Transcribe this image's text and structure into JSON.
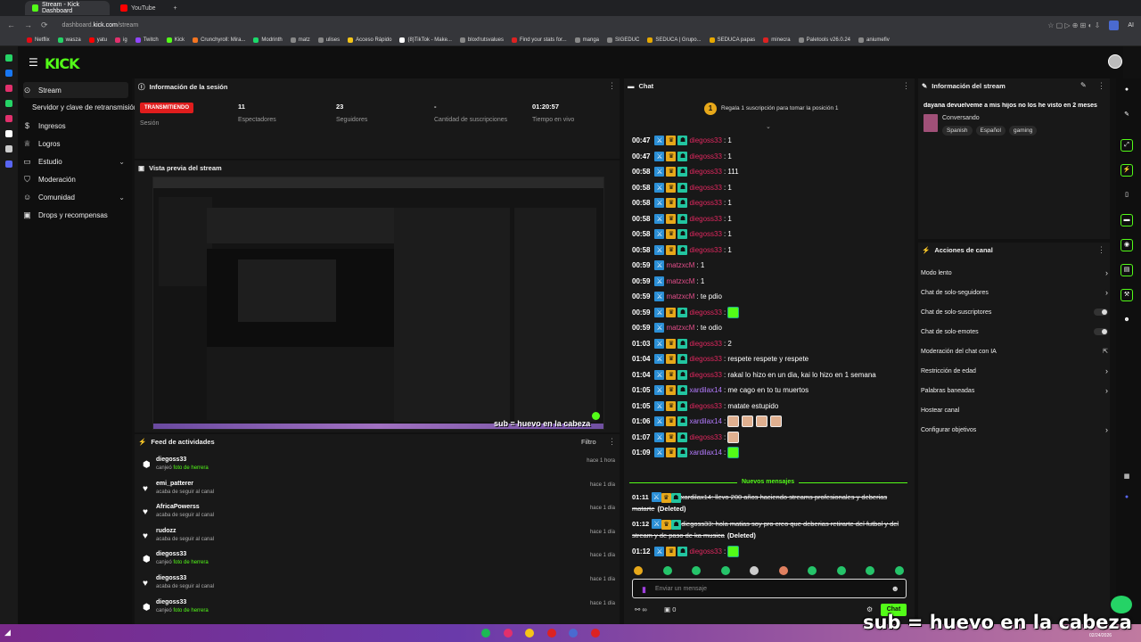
{
  "browser": {
    "tabs": [
      {
        "label": "Stream - Kick Dashboard",
        "color": "#53fc18"
      },
      {
        "label": "YouTube",
        "color": "#ff0000"
      }
    ],
    "url_prefix": "dashboard.",
    "url_domain": "kick.com",
    "url_path": "/stream",
    "ext_label": "AI",
    "bookmarks": [
      {
        "label": "Netflix",
        "color": "#e50914"
      },
      {
        "label": "wasza",
        "color": "#25d366"
      },
      {
        "label": "yatu",
        "color": "#ff0000"
      },
      {
        "label": "ig",
        "color": "#e1306c"
      },
      {
        "label": "Twitch",
        "color": "#9146ff"
      },
      {
        "label": "Kick",
        "color": "#53fc18"
      },
      {
        "label": "Crunchyroll: Mira...",
        "color": "#f47521"
      },
      {
        "label": "Modrinth",
        "color": "#1bd96a"
      },
      {
        "label": "matz",
        "color": "#888888"
      },
      {
        "label": "ulises",
        "color": "#888888"
      },
      {
        "label": "Acceso Rápido",
        "color": "#f5c518"
      },
      {
        "label": "(8)TikTok - Make...",
        "color": "#ffffff"
      },
      {
        "label": "bloxfrutsvalues",
        "color": "#888888"
      },
      {
        "label": "Find your stats for...",
        "color": "#d22"
      },
      {
        "label": "manga",
        "color": "#888888"
      },
      {
        "label": "SIGEDUC",
        "color": "#888888"
      },
      {
        "label": "SEDUCA | Grupo...",
        "color": "#e6a800"
      },
      {
        "label": "SEDUCA papas",
        "color": "#e6a800"
      },
      {
        "label": "minecra",
        "color": "#d22"
      },
      {
        "label": "Paletools v26.0.24",
        "color": "#888888"
      },
      {
        "label": "aniumefiv",
        "color": "#888888"
      }
    ]
  },
  "app": {
    "logo": "KICK",
    "sidebar": [
      {
        "label": "Stream",
        "icon": "broadcast-icon",
        "active": true
      },
      {
        "label": "Servidor y clave de retransmisión",
        "icon": ""
      },
      {
        "label": "Ingresos",
        "icon": "dollar-icon"
      },
      {
        "label": "Logros",
        "icon": "trophy-icon"
      },
      {
        "label": "Estudio",
        "icon": "studio-icon",
        "chevron": true
      },
      {
        "label": "Moderación",
        "icon": "shield-icon"
      },
      {
        "label": "Comunidad",
        "icon": "people-icon",
        "chevron": true
      },
      {
        "label": "Drops y recompensas",
        "icon": "gift-icon"
      }
    ]
  },
  "session": {
    "title": "Información de la sesión",
    "live_badge": "TRANSMITIENDO",
    "session_label": "Sesión",
    "stats": [
      {
        "value": "11",
        "label": "Espectadores"
      },
      {
        "value": "23",
        "label": "Seguidores"
      },
      {
        "value": "-",
        "label": "Cantidad de suscripciones"
      },
      {
        "value": "01:20:57",
        "label": "Tiempo en vivo"
      }
    ]
  },
  "preview": {
    "title": "Vista previa del stream",
    "overlay": "sub = huevo en la cabeza"
  },
  "feed": {
    "title": "Feed de actividades",
    "filter": "Filtro",
    "items": [
      {
        "name": "diegoss33",
        "action": "canjeó ",
        "reward": "foto de herrera",
        "time": "hace 1 hora",
        "icon": "redeem-icon"
      },
      {
        "name": "emi_patterer",
        "action": "acaba de seguir al canal",
        "reward": "",
        "time": "hace 1 día",
        "icon": "heart-icon"
      },
      {
        "name": "AfricaPowerss",
        "action": "acaba de seguir al canal",
        "reward": "",
        "time": "hace 1 día",
        "icon": "heart-icon"
      },
      {
        "name": "rudozz",
        "action": "acaba de seguir al canal",
        "reward": "",
        "time": "hace 1 día",
        "icon": "heart-icon"
      },
      {
        "name": "diegoss33",
        "action": "canjeó ",
        "reward": "foto de herrera",
        "time": "hace 1 día",
        "icon": "redeem-icon"
      },
      {
        "name": "diegoss33",
        "action": "acaba de seguir al canal",
        "reward": "",
        "time": "hace 1 día",
        "icon": "heart-icon"
      },
      {
        "name": "diegoss33",
        "action": "canjeó ",
        "reward": "foto de herrera",
        "time": "hace 1 día",
        "icon": "redeem-icon"
      }
    ]
  },
  "chat": {
    "title": "Chat",
    "pinned_rank": "1",
    "pinned": "Regala 1 suscripción para tomar la posición 1",
    "messages": [
      {
        "time": "00:47",
        "user": "diegoss33",
        "text": ": 1",
        "color": "u-red",
        "badges": 3
      },
      {
        "time": "00:47",
        "user": "diegoss33",
        "text": ": 1",
        "color": "u-red",
        "badges": 3
      },
      {
        "time": "00:58",
        "user": "diegoss33",
        "text": ": 111",
        "color": "u-red",
        "badges": 3
      },
      {
        "time": "00:58",
        "user": "diegoss33",
        "text": ": 1",
        "color": "u-red",
        "badges": 3
      },
      {
        "time": "00:58",
        "user": "diegoss33",
        "text": ": 1",
        "color": "u-red",
        "badges": 3
      },
      {
        "time": "00:58",
        "user": "diegoss33",
        "text": ": 1",
        "color": "u-red",
        "badges": 3
      },
      {
        "time": "00:58",
        "user": "diegoss33",
        "text": ": 1",
        "color": "u-red",
        "badges": 3
      },
      {
        "time": "00:58",
        "user": "diegoss33",
        "text": ": 1",
        "color": "u-red",
        "badges": 3
      },
      {
        "time": "00:59",
        "user": "matzxcM",
        "text": ": 1",
        "color": "u-pink",
        "badges": 1
      },
      {
        "time": "00:59",
        "user": "matzxcM",
        "text": ": 1",
        "color": "u-pink",
        "badges": 1
      },
      {
        "time": "00:59",
        "user": "matzxcM",
        "text": ": te pdio",
        "color": "u-pink",
        "badges": 1
      },
      {
        "time": "00:59",
        "user": "diegoss33",
        "text": ":",
        "color": "u-red",
        "badges": 3,
        "emotes": 1,
        "green": true
      },
      {
        "time": "00:59",
        "user": "matzxcM",
        "text": ": te odio",
        "color": "u-pink",
        "badges": 1
      },
      {
        "time": "01:03",
        "user": "diegoss33",
        "text": ": 2",
        "color": "u-red",
        "badges": 3
      },
      {
        "time": "01:04",
        "user": "diegoss33",
        "text": ": respete respete y respete",
        "color": "u-red",
        "badges": 3
      },
      {
        "time": "01:04",
        "user": "diegoss33",
        "text": ": rakal lo hizo en un dia, kai lo hizo en 1 semana",
        "color": "u-red",
        "badges": 3
      },
      {
        "time": "01:05",
        "user": "xardilax14",
        "text": ": me cago en to tu muertos",
        "color": "u-purple",
        "badges": 3
      },
      {
        "time": "01:05",
        "user": "diegoss33",
        "text": ": matate estupido",
        "color": "u-red",
        "badges": 3
      },
      {
        "time": "01:06",
        "user": "xardilax14",
        "text": ":",
        "color": "u-purple",
        "badges": 3,
        "emotes": 4
      },
      {
        "time": "01:07",
        "user": "diegoss33",
        "text": ":",
        "color": "u-red",
        "badges": 3,
        "emotes": 1
      },
      {
        "time": "01:09",
        "user": "xardilax14",
        "text": ":",
        "color": "u-purple",
        "badges": 3,
        "emotes": 1,
        "green": true
      }
    ],
    "new_messages": "Nuevos mensajes",
    "deleted": [
      {
        "time": "01:11",
        "user": "xardilax14",
        "text": ": llevo 200 años haciendo streams profesionales y deberias matarte",
        "tag": "(Deleted)",
        "color": "u-purple"
      },
      {
        "time": "01:12",
        "user": "diegoss33",
        "text": ": hola matias soy pro creo que deberias retirarte del futbol y del stream y de paso de ka musica",
        "tag": "(Deleted)",
        "color": "u-red"
      }
    ],
    "last": {
      "time": "01:12",
      "user": "diegoss33",
      "text": ":",
      "color": "u-red"
    },
    "input_placeholder": "Enviar un mensaje",
    "footer_count": "0",
    "send_label": "Chat"
  },
  "stream_info": {
    "title": "Información del stream",
    "stream_title": "dayana devuelveme a mis hijos no los he visto en 2 meses",
    "category": "Conversando",
    "tags": [
      "Spanish",
      "Español",
      "gaming"
    ]
  },
  "channel_actions": {
    "title": "Acciones de canal",
    "items": [
      {
        "label": "Modo lento",
        "control": "arrow"
      },
      {
        "label": "Chat de solo-seguidores",
        "control": "arrow"
      },
      {
        "label": "Chat de solo-suscriptores",
        "control": "toggle"
      },
      {
        "label": "Chat de solo-emotes",
        "control": "toggle"
      },
      {
        "label": "Moderación del chat con IA",
        "control": "external"
      },
      {
        "label": "Restricción de edad",
        "control": "arrow"
      },
      {
        "label": "Palabras baneadas",
        "control": "arrow"
      },
      {
        "label": "Hostear canal",
        "control": "none"
      },
      {
        "label": "Configurar objetivos",
        "control": "arrow"
      }
    ]
  },
  "taskbar": {
    "date": "02/24/2026"
  },
  "overlay_text": "sub = huevo en la cabeza",
  "colors": {
    "accent": "#53fc18",
    "live": "#e01d1d"
  }
}
